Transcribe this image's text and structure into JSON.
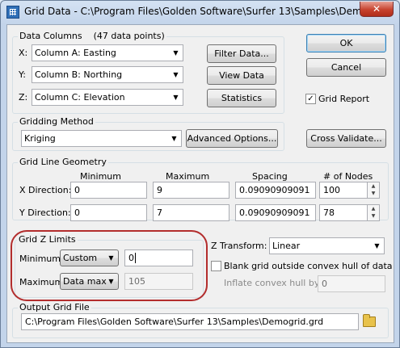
{
  "window": {
    "title": "Grid Data - C:\\Program Files\\Golden Software\\Surfer 13\\Samples\\Demogr...",
    "close_symbol": "✕"
  },
  "data_columns": {
    "label": "Data Columns",
    "count": "(47 data points)",
    "x_label": "X:",
    "y_label": "Y:",
    "z_label": "Z:",
    "x_value": "Column A:  Easting",
    "y_value": "Column B:  Northing",
    "z_value": "Column C:  Elevation",
    "filter_button": "Filter Data...",
    "view_button": "View Data",
    "statistics_button": "Statistics"
  },
  "buttons": {
    "ok": "OK",
    "cancel": "Cancel",
    "grid_report": "Grid Report",
    "cross_validate": "Cross Validate..."
  },
  "grid_report_checked": "✓",
  "gridding": {
    "label": "Gridding Method",
    "method": "Kriging",
    "advanced_button": "Advanced Options..."
  },
  "geometry": {
    "label": "Grid Line Geometry",
    "headers": [
      "Minimum",
      "Maximum",
      "Spacing",
      "# of Nodes"
    ],
    "rows": [
      {
        "label": "X Direction:",
        "min": "0",
        "max": "9",
        "spacing": "0.09090909091",
        "nodes": "100"
      },
      {
        "label": "Y Direction:",
        "min": "0",
        "max": "7",
        "spacing": "0.09090909091",
        "nodes": "78"
      }
    ]
  },
  "z_limits": {
    "label": "Grid Z Limits",
    "min_label": "Minimum:",
    "min_mode": "Custom",
    "min_value": "0",
    "max_label": "Maximum:",
    "max_mode": "Data max",
    "max_value": "105"
  },
  "z_transform": {
    "label": "Z Transform:",
    "value": "Linear"
  },
  "blank_outside_hull": "Blank grid outside convex hull of data",
  "inflate": {
    "label": "Inflate convex hull by:",
    "value": "0"
  },
  "output": {
    "label": "Output Grid File",
    "path": "C:\\Program Files\\Golden Software\\Surfer 13\\Samples\\Demogrid.grd"
  },
  "icons": {
    "title": "surfer-grid-icon",
    "dropdown": "chevron-down-icon",
    "spin": "spin-arrows-icon",
    "open": "folder-open-icon"
  },
  "colors": {
    "highlight_ring": "#b32d2d",
    "default_button_border": "#3c7fb1"
  }
}
